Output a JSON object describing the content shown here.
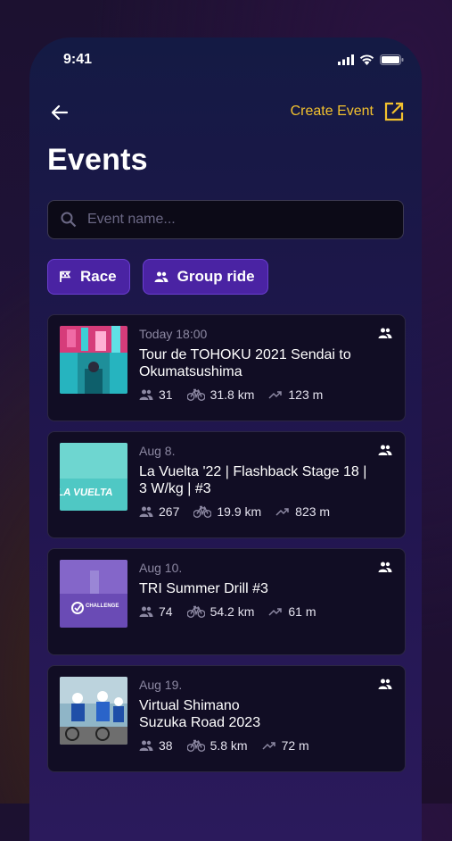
{
  "status": {
    "time": "9:41"
  },
  "header": {
    "create_label": "Create Event",
    "title": "Events"
  },
  "search": {
    "placeholder": "Event name..."
  },
  "filters": [
    {
      "label": "Race",
      "icon": "flag-icon"
    },
    {
      "label": "Group ride",
      "icon": "group-icon"
    }
  ],
  "events": [
    {
      "date": "Today 18:00",
      "name": "Tour de TOHOKU 2021 Sendai to Okumatsushima",
      "participants": "31",
      "distance": "31.8 km",
      "elevation": "123 m"
    },
    {
      "date": "Aug 8.",
      "name": "La Vuelta '22 | Flashback Stage 18 | 3 W/kg | #3",
      "participants": "267",
      "distance": "19.9 km",
      "elevation": "823 m",
      "thumb_text": "LA VUELTA"
    },
    {
      "date": "Aug 10.",
      "name": "TRI Summer Drill #3",
      "participants": "74",
      "distance": "54.2 km",
      "elevation": "61 m",
      "thumb_text": "CHALLENGE"
    },
    {
      "date": "Aug 19.",
      "name": "Virtual Shimano\nSuzuka Road 2023",
      "participants": "38",
      "distance": "5.8 km",
      "elevation": "72 m"
    }
  ],
  "colors": {
    "accent": "#f2c12e",
    "chip": "#4a23a3",
    "card": "#110d24"
  }
}
